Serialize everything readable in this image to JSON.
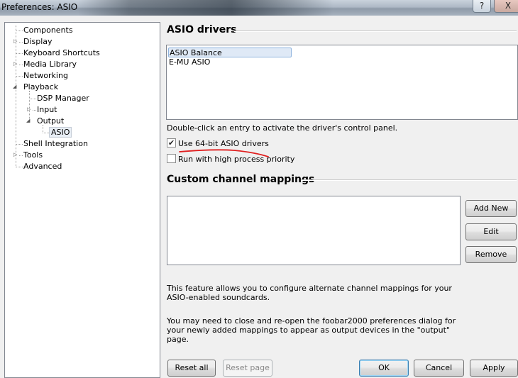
{
  "window": {
    "title": "Preferences: ASIO",
    "help_glyph": "?",
    "close_glyph": "X"
  },
  "tree": {
    "items": [
      {
        "label": "Components"
      },
      {
        "label": "Display"
      },
      {
        "label": "Keyboard Shortcuts"
      },
      {
        "label": "Media Library"
      },
      {
        "label": "Networking"
      },
      {
        "label": "Playback"
      },
      {
        "label": "DSP Manager"
      },
      {
        "label": "Input"
      },
      {
        "label": "Output"
      },
      {
        "label": "ASIO",
        "selected": true
      },
      {
        "label": "Shell Integration"
      },
      {
        "label": "Tools"
      },
      {
        "label": "Advanced"
      }
    ]
  },
  "asio": {
    "section_title": "ASIO drivers",
    "drivers": [
      "ASIO Balance",
      "E-MU ASIO"
    ],
    "hint": "Double-click an entry to activate the driver's control panel.",
    "use64_label": "Use 64-bit ASIO drivers",
    "use64_checked": true,
    "high_priority_label": "Run with high process priority",
    "high_priority_checked": false
  },
  "mappings": {
    "section_title": "Custom channel mappings",
    "add_label": "Add New",
    "edit_label": "Edit",
    "remove_label": "Remove",
    "info1": "This feature allows you to configure alternate channel mappings for your ASIO-enabled soundcards.",
    "info2": "You may need to close and re-open the foobar2000 preferences dialog for your newly added mappings to appear as output devices in the \"output\" page."
  },
  "footer": {
    "reset_all": "Reset all",
    "reset_page": "Reset page",
    "ok": "OK",
    "cancel": "Cancel",
    "apply": "Apply"
  },
  "colors": {
    "annotation_underline": "#e02020"
  }
}
